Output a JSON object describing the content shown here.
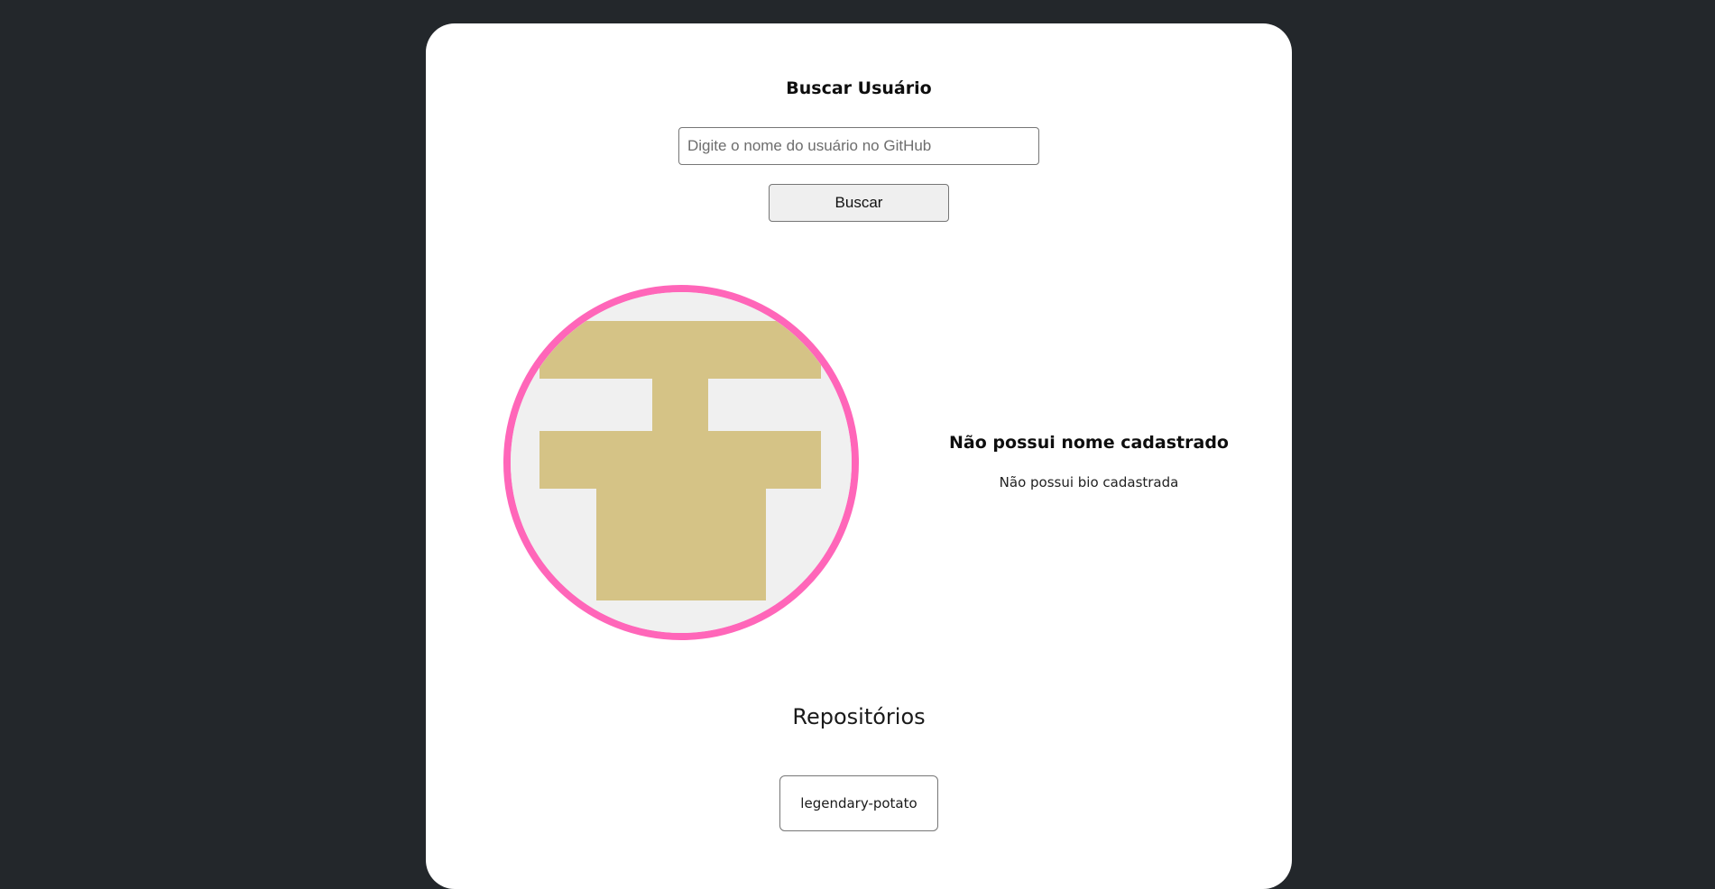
{
  "search": {
    "title": "Buscar Usuário",
    "placeholder": "Digite o nome do usuário no GitHub",
    "value": "",
    "button_label": "Buscar"
  },
  "profile": {
    "avatar": {
      "icon": "identicon-avatar",
      "border_color": "#ff66b9",
      "pattern_color": "#d5c386",
      "background_color": "#f0f0f0"
    },
    "name": "Não possui nome cadastrado",
    "bio": "Não possui bio cadastrada"
  },
  "repositories": {
    "title": "Repositórios",
    "items": [
      {
        "name": "legendary-potato"
      }
    ]
  }
}
